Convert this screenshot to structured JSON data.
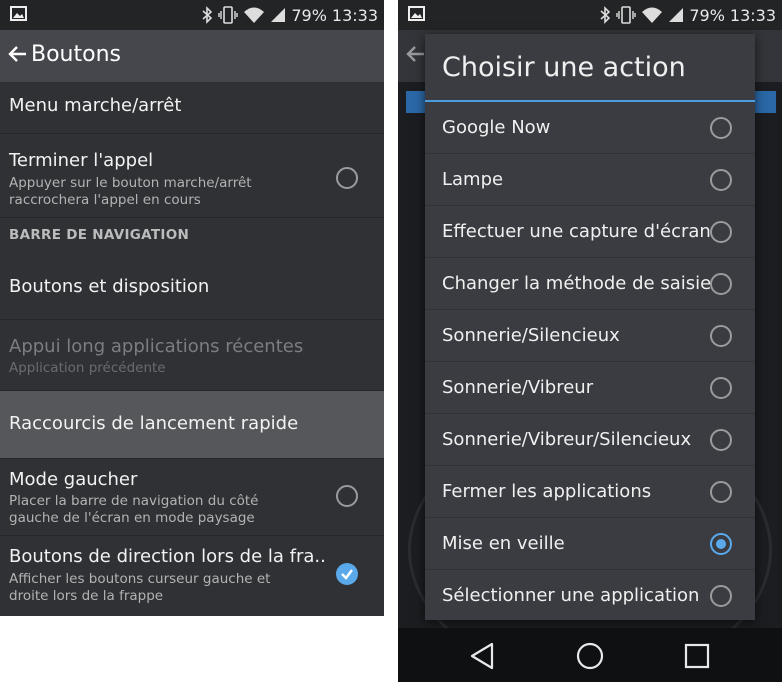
{
  "status": {
    "battery": "79%",
    "time": "13:33"
  },
  "left": {
    "title": "Boutons",
    "rows": [
      {
        "title": "Menu marche/arrêt",
        "subtitle": ""
      },
      {
        "title": "Terminer l'appel",
        "subtitle": "Appuyer sur le bouton marche/arrêt raccrochera l'appel en cours"
      },
      {
        "title": "Boutons et disposition",
        "subtitle": ""
      },
      {
        "title": "Appui long applications récentes",
        "subtitle": "Application précédente"
      },
      {
        "title": "Raccourcis de lancement rapide",
        "subtitle": ""
      },
      {
        "title": "Mode gaucher",
        "subtitle": "Placer la barre de navigation du côté gauche de l'écran en mode paysage"
      },
      {
        "title": "Boutons de direction lors de la fra..",
        "subtitle": "Afficher les boutons curseur gauche et droite lors de la frappe"
      }
    ],
    "section": "BARRE DE NAVIGATION"
  },
  "dialog": {
    "title": "Choisir une action",
    "options": [
      {
        "label": "Google Now",
        "selected": false
      },
      {
        "label": "Lampe",
        "selected": false
      },
      {
        "label": "Effectuer une capture d'écran",
        "selected": false
      },
      {
        "label": "Changer la méthode de saisie",
        "selected": false
      },
      {
        "label": "Sonnerie/Silencieux",
        "selected": false
      },
      {
        "label": "Sonnerie/Vibreur",
        "selected": false
      },
      {
        "label": "Sonnerie/Vibreur/Silencieux",
        "selected": false
      },
      {
        "label": "Fermer les applications",
        "selected": false
      },
      {
        "label": "Mise en veille",
        "selected": true
      },
      {
        "label": "Sélectionner une application",
        "selected": false
      }
    ]
  },
  "colors": {
    "accent": "#4b9de0",
    "checked": "#5aa9ea",
    "highlight": "#56575b"
  },
  "icons": [
    "image-icon",
    "bluetooth-icon",
    "vibrate-icon",
    "wifi-icon",
    "signal-icon",
    "back-arrow-icon",
    "nav-back-icon",
    "nav-home-icon",
    "nav-recents-icon"
  ]
}
